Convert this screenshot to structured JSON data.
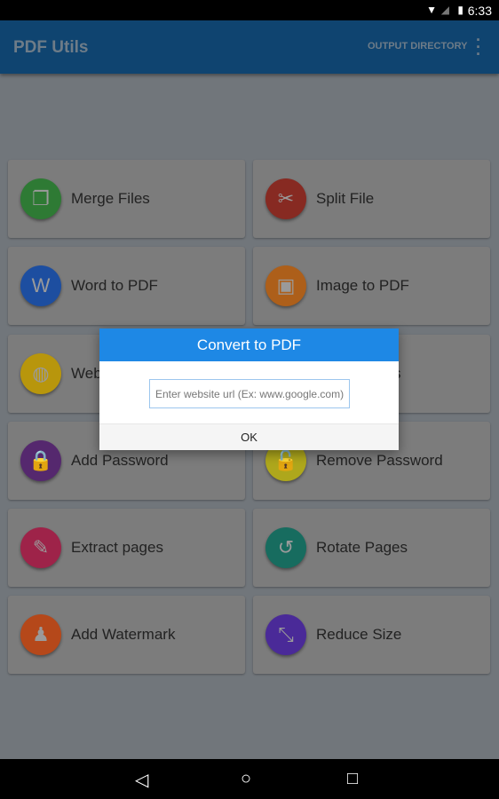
{
  "status": {
    "time": "6:33",
    "icons": [
      "wifi-icon",
      "signal-icon",
      "battery-icon"
    ]
  },
  "appbar": {
    "title": "PDF Utils",
    "output_directory": "OUTPUT DIRECTORY",
    "more": "⋮"
  },
  "cards": [
    {
      "label": "Merge Files",
      "icon": "merge-icon",
      "color": "#2e7a34",
      "glyph": "❐"
    },
    {
      "label": "Split File",
      "icon": "scissors-icon",
      "color": "#872a22",
      "glyph": "✂"
    },
    {
      "label": "Word to PDF",
      "icon": "word-icon",
      "color": "#1d4ea0",
      "glyph": "W"
    },
    {
      "label": "Image to PDF",
      "icon": "image-icon",
      "color": "#ad5f1a",
      "glyph": "▣"
    },
    {
      "label": "Web",
      "icon": "globe-icon",
      "color": "#b8960c",
      "glyph": "◍"
    },
    {
      "label": "s",
      "icon": "file-icon",
      "color": "#7c7c7c",
      "glyph": ""
    },
    {
      "label": "Add Password",
      "icon": "lock-icon",
      "color": "#55286e",
      "glyph": "🔒"
    },
    {
      "label": "Remove Password",
      "icon": "unlock-icon",
      "color": "#aea71c",
      "glyph": "🔓"
    },
    {
      "label": "Extract pages",
      "icon": "extract-icon",
      "color": "#9e2349",
      "glyph": "✎"
    },
    {
      "label": "Rotate Pages",
      "icon": "rotate-icon",
      "color": "#176c5f",
      "glyph": "↺"
    },
    {
      "label": "Add Watermark",
      "icon": "stamp-icon",
      "color": "#b5481a",
      "glyph": "♟"
    },
    {
      "label": "Reduce Size",
      "icon": "compress-icon",
      "color": "#4a2a98",
      "glyph": "⤡"
    }
  ],
  "dialog": {
    "title": "Convert to PDF",
    "placeholder": "Enter website url (Ex: www.google.com)",
    "ok": "OK"
  },
  "nav": {
    "back": "◁",
    "home": "○",
    "recents": "□"
  }
}
